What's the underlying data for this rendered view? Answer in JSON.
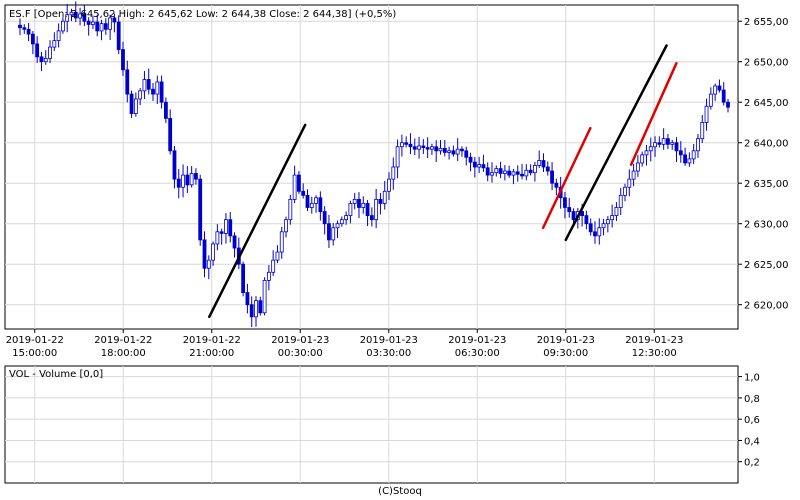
{
  "price_panel": {
    "header": "ES.F [Open: 2 645,62  High: 2 645,62  Low: 2 644,38  Close: 2 644,38] (+0,5%)"
  },
  "volume_panel": {
    "header": "VOL - Volume [0,0]"
  },
  "footer": {
    "credit": "(C)Stooq"
  },
  "colors": {
    "candle": "#0000cc",
    "trend_black": "#000000",
    "trend_red": "#e00000",
    "grid": "#d8d8d8"
  },
  "chart_data": [
    {
      "type": "candlestick",
      "ylim": [
        2617,
        2657
      ],
      "xlim": [
        0,
        720
      ],
      "x_unit": "minutes since 2019-01-22 14:30",
      "yticks": [
        {
          "value": 2620,
          "label": "2 620,00"
        },
        {
          "value": 2625,
          "label": "2 625,00"
        },
        {
          "value": 2630,
          "label": "2 630,00"
        },
        {
          "value": 2635,
          "label": "2 635,00"
        },
        {
          "value": 2640,
          "label": "2 640,00"
        },
        {
          "value": 2645,
          "label": "2 645,00"
        },
        {
          "value": 2650,
          "label": "2 650,00"
        },
        {
          "value": 2655,
          "label": "2 655,00"
        }
      ],
      "xticks": [
        {
          "x": 30,
          "date": "2019-01-22",
          "time": "15:00:00"
        },
        {
          "x": 210,
          "date": "2019-01-22",
          "time": "18:00:00"
        },
        {
          "x": 390,
          "date": "2019-01-22",
          "time": "21:00:00"
        },
        {
          "x": 570,
          "date": "2019-01-23",
          "time": "00:30:00"
        },
        {
          "x": 750,
          "date": "2019-01-23",
          "time": "03:30:00"
        },
        {
          "x": 930,
          "date": "2019-01-23",
          "time": "06:30:00"
        },
        {
          "x": 1110,
          "date": "2019-01-23",
          "time": "09:30:00"
        },
        {
          "x": 1290,
          "date": "2019-01-23",
          "time": "12:30:00"
        }
      ],
      "closes": [
        2654.2,
        2654.0,
        2653.4,
        2652.2,
        2650.6,
        2650.0,
        2650.4,
        2651.8,
        2652.6,
        2653.8,
        2655.0,
        2655.8,
        2656.1,
        2655.4,
        2655.9,
        2655.0,
        2654.6,
        2654.9,
        2653.8,
        2654.7,
        2654.0,
        2655.4,
        2654.9,
        2651.5,
        2649.0,
        2646.0,
        2643.6,
        2645.4,
        2646.4,
        2647.8,
        2646.6,
        2646.0,
        2647.5,
        2645.0,
        2643.0,
        2639.0,
        2635.5,
        2634.5,
        2636.0,
        2634.8,
        2636.2,
        2635.5,
        2628.0,
        2624.5,
        2625.5,
        2627.5,
        2629.0,
        2628.8,
        2630.5,
        2628.5,
        2627.0,
        2625.0,
        2621.5,
        2620.0,
        2618.5,
        2620.5,
        2619.0,
        2623.0,
        2624.0,
        2625.5,
        2626.5,
        2629.0,
        2630.5,
        2633.0,
        2636.0,
        2634.0,
        2633.5,
        2632.0,
        2632.5,
        2633.2,
        2631.5,
        2630.0,
        2628.0,
        2629.5,
        2630.0,
        2630.5,
        2631.0,
        2632.5,
        2633.0,
        2632.0,
        2632.5,
        2631.0,
        2630.5,
        2633.0,
        2632.5,
        2634.0,
        2635.5,
        2637.0,
        2639.5,
        2640.0,
        2639.8,
        2639.5,
        2639.2,
        2639.6,
        2639.4,
        2639.2,
        2639.5,
        2639.0,
        2639.3,
        2638.8,
        2639.0,
        2638.6,
        2639.2,
        2639.0,
        2638.2,
        2637.6,
        2637.0,
        2637.3,
        2636.9,
        2636.0,
        2636.3,
        2636.8,
        2636.2,
        2636.5,
        2636.0,
        2636.4,
        2636.1,
        2635.9,
        2636.6,
        2636.3,
        2637.2,
        2637.8,
        2637.0,
        2636.5,
        2635.0,
        2634.5,
        2633.2,
        2632.0,
        2631.5,
        2630.5,
        2631.5,
        2631.0,
        2630.0,
        2629.0,
        2628.5,
        2629.5,
        2630.0,
        2630.5,
        2631.0,
        2632.0,
        2633.5,
        2634.5,
        2635.5,
        2636.5,
        2637.5,
        2638.5,
        2639.0,
        2639.5,
        2640.0,
        2639.8,
        2640.5,
        2639.8,
        2640.0,
        2639.0,
        2638.5,
        2637.5,
        2638.0,
        2639.0,
        2640.5,
        2642.5,
        2644.5,
        2646.0,
        2647.0,
        2646.5,
        2645.0,
        2644.38
      ],
      "trendlines": [
        {
          "color": "black",
          "x1": 385,
          "y1": 2618.5,
          "x2": 580,
          "y2": 2642.2
        },
        {
          "color": "red",
          "x1": 1064,
          "y1": 2629.5,
          "x2": 1160,
          "y2": 2641.8
        },
        {
          "color": "black",
          "x1": 1110,
          "y1": 2628.0,
          "x2": 1315,
          "y2": 2652.0
        },
        {
          "color": "red",
          "x1": 1243,
          "y1": 2637.3,
          "x2": 1335,
          "y2": 2649.8
        }
      ]
    },
    {
      "type": "bar",
      "title": "VOL - Volume [0,0]",
      "ylim": [
        0,
        1.1
      ],
      "yticks": [
        {
          "value": 0.2,
          "label": "0,2"
        },
        {
          "value": 0.4,
          "label": "0,4"
        },
        {
          "value": 0.6,
          "label": "0,6"
        },
        {
          "value": 0.8,
          "label": "0,8"
        },
        {
          "value": 1.0,
          "label": "1,0"
        }
      ],
      "values": []
    }
  ]
}
